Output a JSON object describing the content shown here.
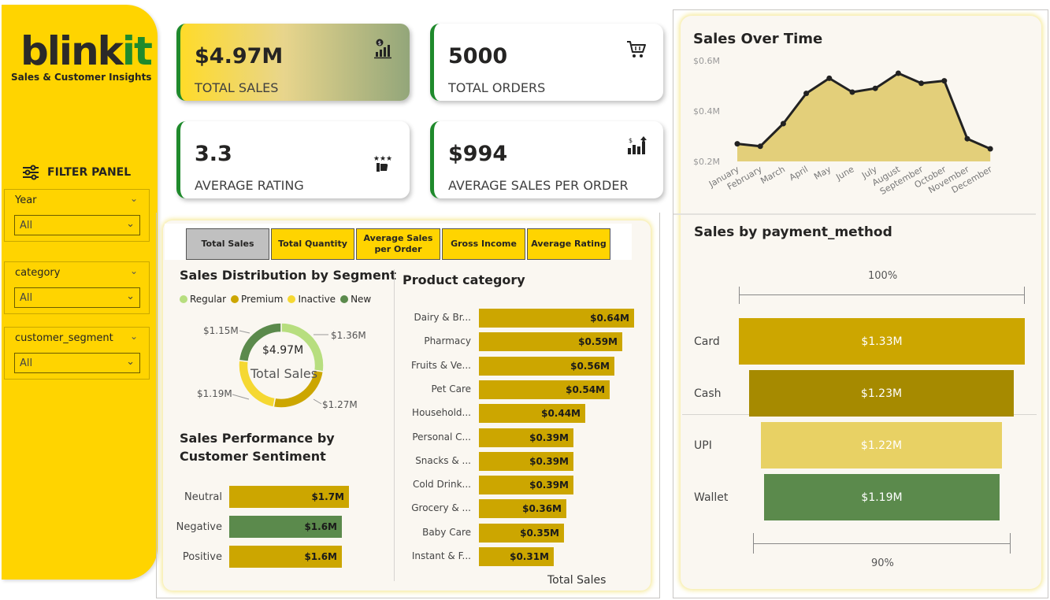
{
  "brand": {
    "name_part1": "blink",
    "name_part2": "it",
    "subtitle": "Sales & Customer Insights"
  },
  "filter_panel": {
    "title": "FILTER PANEL",
    "filters": [
      {
        "label": "Year",
        "value": "All"
      },
      {
        "label": "category",
        "value": "All"
      },
      {
        "label": "customer_segment",
        "value": "All"
      }
    ]
  },
  "kpis": [
    {
      "value": "$4.97M",
      "label": "TOTAL SALES",
      "icon": "sales-chart-icon"
    },
    {
      "value": "5000",
      "label": "TOTAL ORDERS",
      "icon": "shopping-cart-icon"
    },
    {
      "value": "3.3",
      "label": "AVERAGE RATING",
      "icon": "rating-stars-icon"
    },
    {
      "value": "$994",
      "label": "AVERAGE SALES PER ORDER",
      "icon": "growth-chart-icon"
    }
  ],
  "measure_buttons": [
    "Total Sales",
    "Total Quantity",
    "Average Sales per Order",
    "Gross Income",
    "Average Rating"
  ],
  "segment_chart": {
    "title": "Sales Distribution by Segment",
    "center_value": "$4.97M",
    "center_label": "Total Sales",
    "legend": [
      {
        "name": "Regular",
        "color": "#b7de7f"
      },
      {
        "name": "Premium",
        "color": "#cca600"
      },
      {
        "name": "Inactive",
        "color": "#f5d832"
      },
      {
        "name": "New",
        "color": "#5b8a4c"
      }
    ],
    "labels": {
      "regular": "$1.36M",
      "premium": "$1.27M",
      "inactive": "$1.19M",
      "new": "$1.15M"
    }
  },
  "sentiment_chart": {
    "title": "Sales Performance by Customer Sentiment",
    "rows": [
      {
        "name": "Neutral",
        "label": "$1.7M"
      },
      {
        "name": "Negative",
        "label": "$1.6M"
      },
      {
        "name": "Positive",
        "label": "$1.6M"
      }
    ]
  },
  "category_chart": {
    "title": "Product category",
    "axis_label": "Total Sales",
    "rows": [
      {
        "name": "Dairy & Br...",
        "label": "$0.64M"
      },
      {
        "name": "Pharmacy",
        "label": "$0.59M"
      },
      {
        "name": "Fruits & Ve...",
        "label": "$0.56M"
      },
      {
        "name": "Pet Care",
        "label": "$0.54M"
      },
      {
        "name": "Household...",
        "label": "$0.44M"
      },
      {
        "name": "Personal C...",
        "label": "$0.39M"
      },
      {
        "name": "Snacks & ...",
        "label": "$0.39M"
      },
      {
        "name": "Cold Drink...",
        "label": "$0.39M"
      },
      {
        "name": "Grocery & ...",
        "label": "$0.36M"
      },
      {
        "name": "Baby Care",
        "label": "$0.35M"
      },
      {
        "name": "Instant & F...",
        "label": "$0.31M"
      }
    ]
  },
  "time_chart": {
    "title": "Sales Over Time",
    "y_ticks": [
      "$0.6M",
      "$0.4M",
      "$0.2M"
    ],
    "months": [
      "January",
      "February",
      "March",
      "April",
      "May",
      "June",
      "July",
      "August",
      "September",
      "October",
      "November",
      "December"
    ]
  },
  "payment_chart": {
    "title": "Sales by payment_method",
    "top_label": "100%",
    "bottom_label": "90%",
    "rows": [
      {
        "name": "Card",
        "label": "$1.33M",
        "color": "#cca600"
      },
      {
        "name": "Cash",
        "label": "$1.23M",
        "color": "#a68a00"
      },
      {
        "name": "UPI",
        "label": "$1.22M",
        "color": "#e8d164"
      },
      {
        "name": "Wallet",
        "label": "$1.19M",
        "color": "#5b8a4c"
      }
    ]
  },
  "chart_data": [
    {
      "type": "pie",
      "title": "Sales Distribution by Segment",
      "categories": [
        "Regular",
        "Premium",
        "Inactive",
        "New"
      ],
      "values": [
        1.36,
        1.27,
        1.19,
        1.15
      ],
      "unit": "$M"
    },
    {
      "type": "bar",
      "title": "Sales Performance by Customer Sentiment",
      "categories": [
        "Neutral",
        "Negative",
        "Positive"
      ],
      "values": [
        1.7,
        1.6,
        1.6
      ],
      "unit": "$M"
    },
    {
      "type": "bar",
      "title": "Product category",
      "xlabel": "Total Sales",
      "categories": [
        "Dairy & Br...",
        "Pharmacy",
        "Fruits & Ve...",
        "Pet Care",
        "Household...",
        "Personal C...",
        "Snacks & ...",
        "Cold Drink...",
        "Grocery & ...",
        "Baby Care",
        "Instant & F..."
      ],
      "values": [
        0.64,
        0.59,
        0.56,
        0.54,
        0.44,
        0.39,
        0.39,
        0.39,
        0.36,
        0.35,
        0.31
      ],
      "unit": "$M"
    },
    {
      "type": "area",
      "title": "Sales Over Time",
      "x": [
        "January",
        "February",
        "March",
        "April",
        "May",
        "June",
        "July",
        "August",
        "September",
        "October",
        "November",
        "December"
      ],
      "values": [
        0.27,
        0.26,
        0.35,
        0.47,
        0.53,
        0.475,
        0.49,
        0.55,
        0.51,
        0.52,
        0.29,
        0.25
      ],
      "ylim": [
        0.2,
        0.6
      ],
      "unit": "$M"
    },
    {
      "type": "bar",
      "title": "Sales by payment_method",
      "categories": [
        "Card",
        "Cash",
        "UPI",
        "Wallet"
      ],
      "values": [
        1.33,
        1.23,
        1.22,
        1.19
      ],
      "unit": "$M"
    }
  ]
}
